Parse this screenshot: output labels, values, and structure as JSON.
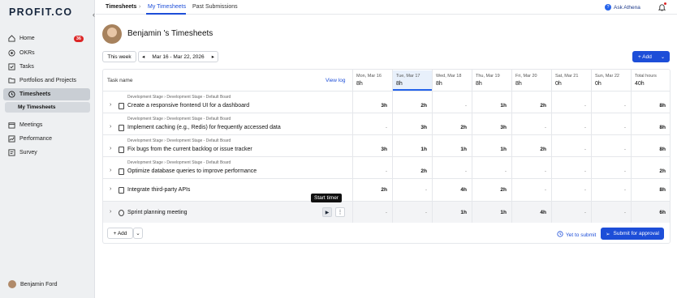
{
  "sidebar": {
    "logo": "PROFIT.CO",
    "items": [
      {
        "label": "Home",
        "badge": "36"
      },
      {
        "label": "OKRs"
      },
      {
        "label": "Tasks"
      },
      {
        "label": "Portfolios and Projects"
      },
      {
        "label": "Timesheets",
        "active": true
      },
      {
        "label": "My Timesheets",
        "sub": true
      },
      {
        "label": "Meetings"
      },
      {
        "label": "Performance"
      },
      {
        "label": "Survey"
      }
    ],
    "user": "Benjamin Ford"
  },
  "topbar": {
    "breadcrumb": "Timesheets",
    "separator": "›",
    "tabs": [
      "My Timesheets",
      "Past Submissions"
    ],
    "ask": "Ask Athena"
  },
  "header": {
    "title": "Benjamin 's Timesheets",
    "this_week": "This week",
    "range": "Mar 16 - Mar 22, 2026",
    "add": "+ Add"
  },
  "table": {
    "task_header": "Task name",
    "view_log": "View log",
    "columns": [
      {
        "day": "Mon, Mar 16",
        "total": "8h"
      },
      {
        "day": "Tue, Mar 17",
        "total": "8h",
        "today": true
      },
      {
        "day": "Wed, Mar 18",
        "total": "8h"
      },
      {
        "day": "Thu, Mar 19",
        "total": "8h"
      },
      {
        "day": "Fri, Mar 20",
        "total": "8h"
      },
      {
        "day": "Sat, Mar 21",
        "total": "0h"
      },
      {
        "day": "Sun, Mar 22",
        "total": "0h"
      },
      {
        "day": "Total hours",
        "total": "40h"
      }
    ],
    "rows": [
      {
        "path": "Development Stage › Development Stage - Default Board",
        "name": "Create a responsive frontend UI for a dashboard",
        "values": [
          "3h",
          "2h",
          "-",
          "1h",
          "2h",
          "-",
          "-",
          "8h"
        ]
      },
      {
        "path": "Development Stage › Development Stage - Default Board",
        "name": "Implement caching (e.g., Redis) for frequently accessed data",
        "values": [
          "-",
          "3h",
          "2h",
          "3h",
          "-",
          "-",
          "-",
          "8h"
        ]
      },
      {
        "path": "Development Stage › Development Stage - Default Board",
        "name": "Fix bugs from the current backlog or issue tracker",
        "values": [
          "3h",
          "1h",
          "1h",
          "1h",
          "2h",
          "-",
          "-",
          "8h"
        ]
      },
      {
        "path": "Development Stage › Development Stage - Default Board",
        "name": "Optimize database queries to improve performance",
        "values": [
          "-",
          "2h",
          "-",
          "-",
          "-",
          "-",
          "-",
          "2h"
        ]
      },
      {
        "path": "",
        "name": "Integrate third-party APIs",
        "values": [
          "2h",
          "-",
          "4h",
          "2h",
          "-",
          "-",
          "-",
          "8h"
        ]
      },
      {
        "path": "",
        "name": "Sprint planning meeting",
        "values": [
          "-",
          "-",
          "1h",
          "1h",
          "4h",
          "-",
          "-",
          "6h"
        ],
        "clock": true
      }
    ],
    "tooltip": "Start timer"
  },
  "footer": {
    "add": "+ Add",
    "yet": "Yet to submit",
    "submit": "Submit for approval"
  }
}
